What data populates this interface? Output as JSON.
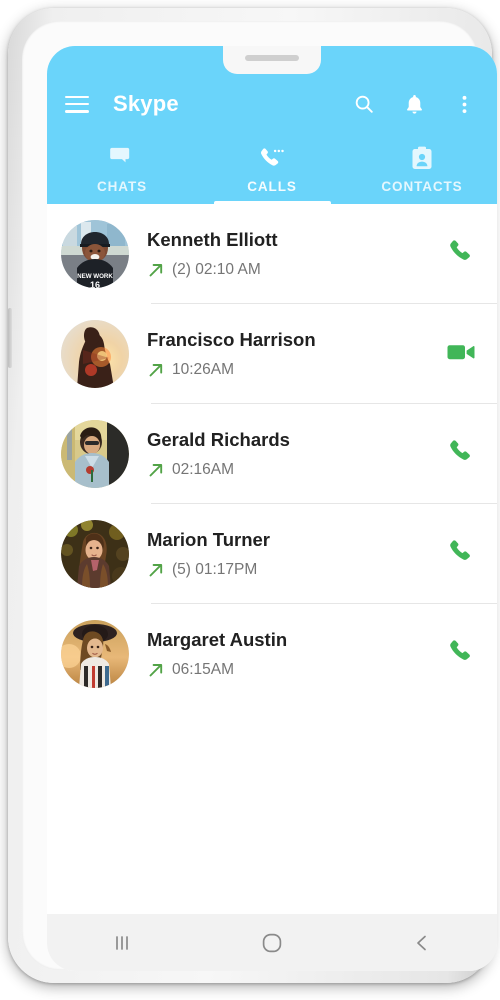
{
  "device": {
    "notch": "earpiece-speaker",
    "nav": {
      "recents_label": "recents-icon",
      "home_label": "home-icon",
      "back_label": "back-icon"
    }
  },
  "header": {
    "title": "Skype",
    "menu_icon": "hamburger-icon",
    "actions": [
      {
        "name": "search-icon",
        "label": "Search"
      },
      {
        "name": "notifications-icon",
        "label": "Notifications"
      },
      {
        "name": "overflow-menu-icon",
        "label": "More options"
      }
    ],
    "background_color": "#6ad4fa",
    "text_color": "#ffffff"
  },
  "tabs": {
    "active_index": 1,
    "items": [
      {
        "label": "CHATS",
        "icon": "chat-bubbles-icon"
      },
      {
        "label": "CALLS",
        "icon": "phone-dots-icon"
      },
      {
        "label": "CONTACTS",
        "icon": "contact-card-icon"
      }
    ]
  },
  "calls": {
    "accent_green": "#41b658",
    "items": [
      {
        "name": "Kenneth Elliott",
        "time": "(2) 02:10 AM",
        "direction": "outgoing",
        "direction_icon": "outgoing-call-arrow-icon",
        "action": "voice-call",
        "action_icon": "phone-icon",
        "avatar": "avatar-kenneth-elliott"
      },
      {
        "name": "Francisco Harrison",
        "time": "10:26AM",
        "direction": "outgoing",
        "direction_icon": "outgoing-call-arrow-icon",
        "action": "video-call",
        "action_icon": "video-camera-icon",
        "avatar": "avatar-francisco-harrison"
      },
      {
        "name": "Gerald Richards",
        "time": "02:16AM",
        "direction": "outgoing",
        "direction_icon": "outgoing-call-arrow-icon",
        "action": "voice-call",
        "action_icon": "phone-icon",
        "avatar": "avatar-gerald-richards"
      },
      {
        "name": "Marion Turner",
        "time": "(5) 01:17PM",
        "direction": "outgoing",
        "direction_icon": "outgoing-call-arrow-icon",
        "action": "voice-call",
        "action_icon": "phone-icon",
        "avatar": "avatar-marion-turner"
      },
      {
        "name": "Margaret Austin",
        "time": "06:15AM",
        "direction": "outgoing",
        "direction_icon": "outgoing-call-arrow-icon",
        "action": "voice-call",
        "action_icon": "phone-icon",
        "avatar": "avatar-margaret-austin"
      }
    ]
  }
}
